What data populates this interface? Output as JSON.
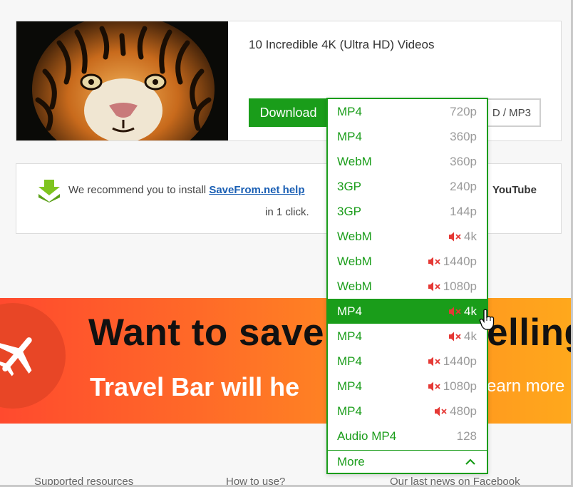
{
  "video": {
    "title": "10 Incredible 4K (Ultra HD) Videos",
    "download_label": "Download",
    "hd_mp3_label": "D / MP3"
  },
  "recommend": {
    "text_before": "We recommend you to install ",
    "link_text": "SaveFrom.net help",
    "youtube_text": "YouTube",
    "text_line2": "in 1 click."
  },
  "ad": {
    "headline": "Want to save",
    "headline_tail": "elling",
    "subline": "Travel Bar will he",
    "learn_more": "earn more"
  },
  "footer": {
    "link1": "Supported resources",
    "link2": "How to use?",
    "link3": "Our last news on Facebook"
  },
  "dropdown": {
    "items": [
      {
        "format": "MP4",
        "quality": "720p",
        "muted": false,
        "active": false
      },
      {
        "format": "MP4",
        "quality": "360p",
        "muted": false,
        "active": false
      },
      {
        "format": "WebM",
        "quality": "360p",
        "muted": false,
        "active": false
      },
      {
        "format": "3GP",
        "quality": "240p",
        "muted": false,
        "active": false
      },
      {
        "format": "3GP",
        "quality": "144p",
        "muted": false,
        "active": false
      },
      {
        "format": "WebM",
        "quality": "4k",
        "muted": true,
        "active": false
      },
      {
        "format": "WebM",
        "quality": "1440p",
        "muted": true,
        "active": false
      },
      {
        "format": "WebM",
        "quality": "1080p",
        "muted": true,
        "active": false
      },
      {
        "format": "MP4",
        "quality": "4k",
        "muted": true,
        "active": true
      },
      {
        "format": "MP4",
        "quality": "4k",
        "muted": true,
        "active": false
      },
      {
        "format": "MP4",
        "quality": "1440p",
        "muted": true,
        "active": false
      },
      {
        "format": "MP4",
        "quality": "1080p",
        "muted": true,
        "active": false
      },
      {
        "format": "MP4",
        "quality": "480p",
        "muted": true,
        "active": false
      },
      {
        "format": "Audio MP4",
        "quality": "128",
        "muted": false,
        "active": false
      }
    ],
    "more_label": "More"
  },
  "colors": {
    "brand_green": "#1a9d1a",
    "mute_red": "#e53935",
    "link_blue": "#1a5fb4"
  },
  "icons": {
    "download_arrow": "download-arrow-icon",
    "mute": "speaker-muted-icon",
    "chevron": "chevron-up-icon",
    "plane": "airplane-icon",
    "cursor": "hand-pointer-icon"
  }
}
